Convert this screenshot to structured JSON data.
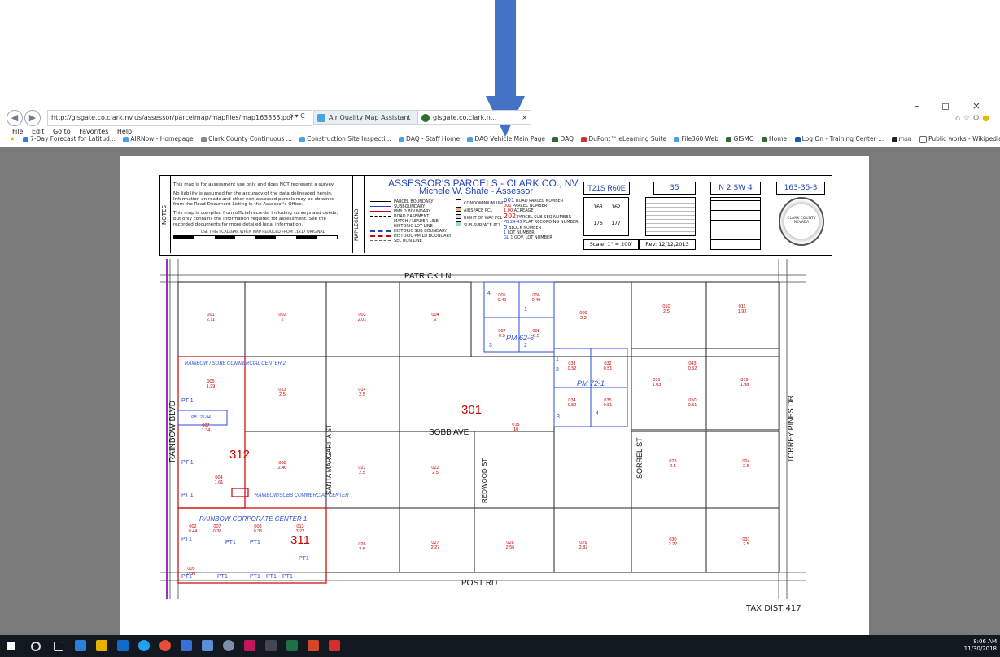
{
  "browser": {
    "url": "http://gisgate.co.clark.nv.us/assessor/parcelmap/mapfiles/map163353.pdf",
    "search_refresh": "ρ ▾ Ç",
    "tabs": [
      {
        "label": "Air Quality Map Assistant"
      },
      {
        "label": "gisgate.co.clark.n..."
      }
    ],
    "tab_close": "×",
    "menu": [
      "File",
      "Edit",
      "Go to",
      "Favorites",
      "Help"
    ],
    "favorites": [
      "7-Day Forecast for Latitud...",
      "AIRNow - Homepage",
      "Clark County Continuous ...",
      "Construction Site Inspecti...",
      "DAQ - Staff Home",
      "DAQ Vehicle Main Page",
      "DAQ",
      "DuPont™ eLearning Suite",
      "File360 Web",
      "GISMO",
      "Home",
      "Log On - Training Center ...",
      "msn",
      "Public works - Wikipedia, ..."
    ],
    "window_controls": "– ◻ ×"
  },
  "map_header": {
    "notes_label": "NOTES",
    "notes": [
      "This map is for assessment use only and does NOT represent a survey.",
      "No liability is assumed for the accuracy of the data delineated herein.",
      "Information on roads and other non-assessed parcels may be obtained",
      "from the Road Document Listing in the Assessor's Office.",
      "This map is compiled from official records, including surveys and deeds,",
      "but only contains the information required for assessment. See the",
      "recorded documents for more detailed legal information.",
      "USE THIS SCALEBAR WHEN MAP REDUCED FROM 11x17 ORIGINAL"
    ],
    "map_legend_label": "MAP LEGEND",
    "title": "ASSESSOR'S PARCELS - CLARK CO., NV.",
    "assessor": "Michele W. Shafe - Assessor",
    "legend_lines": [
      "PARCEL BOUNDARY",
      "SUBBOUNDARY",
      "PM/LD BOUNDARY",
      "ROAD EASEMENT",
      "MATCH / LEADER LINE",
      "HISTORIC LOT LINE",
      "HISTORIC SUB BOUNDARY",
      "HISTORIC PM/LD BOUNDARY",
      "SECTION LINE"
    ],
    "legend_fills": [
      "CONDOMINIUM UNIT",
      "AIRSPACE PCL",
      "RIGHT OF WAY PCL",
      "SUB-SURFACE PCL"
    ],
    "legend_numbers": [
      {
        "code": "001",
        "label": "ROAD PARCEL NUMBER"
      },
      {
        "code": "001",
        "label": "PARCEL NUMBER"
      },
      {
        "code": "1.00",
        "label": "ACREAGE"
      },
      {
        "code": "202",
        "label": "PARCEL SUB-SEQ NUMBER"
      },
      {
        "code": "PB 24-45",
        "label": "PLAT RECORDING NUMBER"
      },
      {
        "code": "5",
        "label": "BLOCK NUMBER"
      },
      {
        "code": "1",
        "label": "LOT NUMBER"
      },
      {
        "code": "GL 1",
        "label": "GOV. LOT NUMBER"
      }
    ],
    "township": "T21S R60E",
    "section": "35",
    "quarter": "N 2 SW 4",
    "map_number": "163-35-3",
    "section_grid": [
      "163",
      "162",
      "176",
      "177"
    ],
    "scale": "Scale: 1\" = 200'",
    "rev": "Rev: 12/12/2013",
    "seal": "CLARK COUNTY NEVADA"
  },
  "map": {
    "streets": [
      "PATRICK LN",
      "RAINBOW BLVD",
      "SANTA MARGARITA ST",
      "SOBB AVE",
      "REDWOOD ST",
      "SORREL ST",
      "TORREY PINES DR",
      "POST RD"
    ],
    "book_pages": [
      "301",
      "312",
      "311"
    ],
    "subdivisions": [
      "RAINBOW / SOBB COMMERCIAL CENTER 2",
      "RAINBOW/SOBB COMMERCIAL CENTER",
      "RAINBOW CORPORATE CENTER 1",
      "PM 62-6",
      "PM 72-1",
      "PB 126-94"
    ],
    "parcels": [
      {
        "num": "001",
        "acres": "2.11"
      },
      {
        "num": "002",
        "acres": "2"
      },
      {
        "num": "003",
        "acres": "2.01"
      },
      {
        "num": "004",
        "acres": "2"
      },
      {
        "num": "005",
        "acres": "0.49"
      },
      {
        "num": "006",
        "acres": "0.49"
      },
      {
        "num": "007",
        "acres": "0.5"
      },
      {
        "num": "008",
        "acres": "0.5"
      },
      {
        "num": "009",
        "acres": "2.2"
      },
      {
        "num": "010",
        "acres": "2.5"
      },
      {
        "num": "011",
        "acres": "1.93"
      },
      {
        "num": "005",
        "acres": "1.29"
      },
      {
        "num": "013",
        "acres": "2.5"
      },
      {
        "num": "014",
        "acres": "2.5"
      },
      {
        "num": "015",
        "acres": "10"
      },
      {
        "num": "033",
        "acres": "0.52"
      },
      {
        "num": "032",
        "acres": "0.51"
      },
      {
        "num": "034",
        "acres": "0.52"
      },
      {
        "num": "035",
        "acres": "0.51"
      },
      {
        "num": "031",
        "acres": "1.03"
      },
      {
        "num": "043",
        "acres": "0.52"
      },
      {
        "num": "050",
        "acres": "0.51"
      },
      {
        "num": "019",
        "acres": "1.98"
      },
      {
        "num": "007",
        "acres": "1.34"
      },
      {
        "num": "004",
        "acres": "1.61"
      },
      {
        "num": "008",
        "acres": "2.40"
      },
      {
        "num": "021",
        "acres": "2.5"
      },
      {
        "num": "022",
        "acres": "2.5"
      },
      {
        "num": "023",
        "acres": "2.5"
      },
      {
        "num": "024",
        "acres": "2.5"
      },
      {
        "num": "002",
        "acres": "0.44"
      },
      {
        "num": "007",
        "acres": "0.38"
      },
      {
        "num": "008",
        "acres": "0.36"
      },
      {
        "num": "013",
        "acres": "3.22"
      },
      {
        "num": "005",
        "acres": "0.36"
      },
      {
        "num": "026",
        "acres": "2.5"
      },
      {
        "num": "027",
        "acres": "2.27"
      },
      {
        "num": "028",
        "acres": "2.56"
      },
      {
        "num": "029",
        "acres": "2.82"
      },
      {
        "num": "030",
        "acres": "2.27"
      },
      {
        "num": "031",
        "acres": "2.5"
      }
    ],
    "pt_labels": [
      "PT 1",
      "PT 1",
      "PT 1",
      "PT1",
      "PT1",
      "PT1",
      "PT1",
      "PT1",
      "PT1",
      "PT1",
      "PT1",
      "PT1"
    ],
    "lot_numbers": [
      "4",
      "1",
      "3",
      "2",
      "1",
      "2",
      "3",
      "4"
    ]
  },
  "tax_district": "TAX DIST  417",
  "taskbar": {
    "time": "8:06 AM",
    "date": "11/30/2018"
  }
}
